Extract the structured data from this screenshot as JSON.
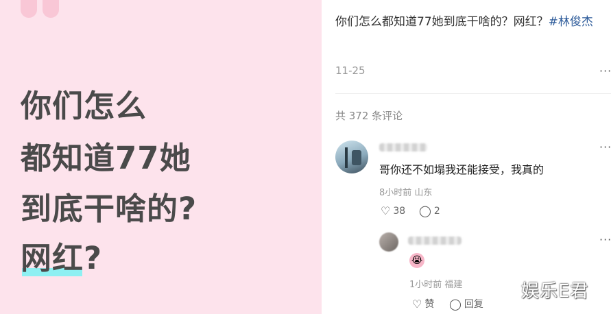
{
  "poster": {
    "lines": [
      "你们怎么",
      "都知道77她",
      "到底干啥的?"
    ],
    "highlight": "网红",
    "highlight_suffix": "?",
    "bg_color": "#fde3ec",
    "highlight_color": "#8ef0f2"
  },
  "post": {
    "title": "你们怎么都知道77她到底干啥的？网红？",
    "tag": "#林俊杰",
    "date": "11-25",
    "more": "···"
  },
  "comments_count": "共 372 条评论",
  "comment1": {
    "text": "哥你还不如塌我还能接受，我真的",
    "meta": "8小时前 山东",
    "likes": "38",
    "replies": "2",
    "more": "···"
  },
  "comment2": {
    "emoji": "😭",
    "meta": "1小时前 福建",
    "like_label": "赞",
    "reply_label": "回复",
    "more": "···"
  },
  "icons": {
    "like": "heart-icon",
    "reply": "comment-bubble-icon",
    "more": "more-dots-icon"
  },
  "watermark": "娱乐E君"
}
